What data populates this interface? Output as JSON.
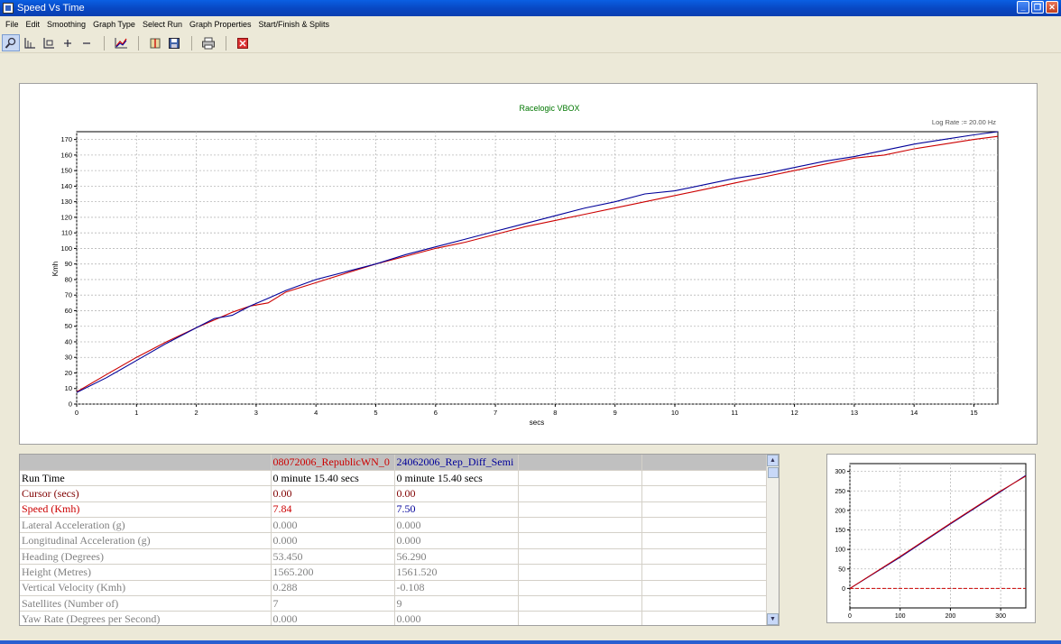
{
  "window": {
    "title": "Speed Vs Time"
  },
  "menu": [
    "File",
    "Edit",
    "Smoothing",
    "Graph Type",
    "Select Run",
    "Graph Properties",
    "Start/Finish & Splits"
  ],
  "colors": {
    "run1": "#cc0000",
    "run2": "#000099",
    "title": "#007700",
    "grid": "#c0c0c0"
  },
  "toolbar_icons": [
    "magnify-icon",
    "axis-icon",
    "zoom-axis-icon",
    "crosshair-icon",
    "minus-icon",
    "graph-settings-icon",
    "split-icon",
    "save-icon",
    "print-icon",
    "close-red-icon"
  ],
  "chart_data": [
    {
      "type": "line",
      "title": "Racelogic VBOX",
      "subtitle": "Log Rate := 20.00 Hz",
      "xlabel": "secs",
      "ylabel": "Kmh",
      "xlim": [
        0,
        15.4
      ],
      "ylim": [
        0,
        175
      ],
      "xticks": [
        0,
        1,
        2,
        3,
        4,
        5,
        6,
        7,
        8,
        9,
        10,
        11,
        12,
        13,
        14,
        15
      ],
      "yticks": [
        0,
        10,
        20,
        30,
        40,
        50,
        60,
        70,
        80,
        90,
        100,
        110,
        120,
        130,
        140,
        150,
        160,
        170
      ],
      "grid": true,
      "series": [
        {
          "color": "#cc0000",
          "x": [
            0,
            0.5,
            1,
            1.5,
            2,
            2.3,
            2.6,
            2.9,
            3.2,
            3.5,
            4,
            4.5,
            5,
            5.5,
            6,
            6.5,
            7,
            7.5,
            8,
            8.5,
            9,
            9.5,
            10,
            10.5,
            11,
            11.5,
            12,
            12.5,
            13,
            13.5,
            14,
            14.5,
            15,
            15.4
          ],
          "y": [
            7.8,
            19,
            30,
            40,
            49,
            54,
            59,
            63,
            65,
            72,
            78,
            84,
            90,
            95,
            100,
            104,
            109,
            114,
            118,
            122,
            126,
            130,
            134,
            138,
            142,
            146,
            150,
            154,
            158,
            160,
            164,
            167,
            170,
            172
          ]
        },
        {
          "color": "#000099",
          "x": [
            0,
            0.5,
            1,
            1.5,
            2,
            2.3,
            2.6,
            2.9,
            3.2,
            3.5,
            4,
            4.5,
            5,
            5.5,
            6,
            6.5,
            7,
            7.5,
            8,
            8.5,
            9,
            9.5,
            10,
            10.5,
            11,
            11.5,
            12,
            12.5,
            13,
            13.5,
            14,
            14.5,
            15,
            15.4
          ],
          "y": [
            7.5,
            17,
            28,
            39,
            49,
            55,
            57,
            63,
            68,
            73,
            80,
            85,
            90,
            96,
            101,
            106,
            111,
            116,
            121,
            126,
            130,
            135,
            137,
            141,
            145,
            148,
            152,
            156,
            159,
            163,
            167,
            170,
            173,
            175
          ]
        }
      ]
    },
    {
      "type": "line",
      "title": "",
      "xlim": [
        0,
        350
      ],
      "ylim": [
        -50,
        320
      ],
      "xticks": [
        0,
        100,
        200,
        300
      ],
      "yticks": [
        0,
        50,
        100,
        150,
        200,
        250,
        300
      ],
      "grid": true,
      "series": [
        {
          "color": "#000099",
          "x": [
            0,
            100,
            200,
            300,
            350
          ],
          "y": [
            0,
            80,
            165,
            248,
            290
          ]
        },
        {
          "color": "#cc0000",
          "x": [
            0,
            100,
            200,
            300,
            350
          ],
          "y": [
            0,
            82,
            167,
            250,
            288
          ]
        },
        {
          "color": "#cc0000",
          "x": [
            0,
            350
          ],
          "y": [
            0,
            0
          ]
        }
      ]
    }
  ],
  "table": {
    "columns": [
      "",
      "08072006_RepublicWN_0",
      "24062006_Rep_Diff_Semi",
      "",
      ""
    ],
    "rows": [
      {
        "label": "Run Time",
        "v1": "0 minute 15.40 secs",
        "v2": "0 minute 15.40 secs",
        "style": "black"
      },
      {
        "label": "Cursor (secs)",
        "v1": "0.00",
        "v2": "0.00",
        "style": "dark"
      },
      {
        "label": "Speed (Kmh)",
        "v1": "7.84",
        "v2": "7.50",
        "style": "speed"
      },
      {
        "label": "Lateral Acceleration (g)",
        "v1": "0.000",
        "v2": "0.000",
        "style": "grey"
      },
      {
        "label": "Longitudinal Acceleration (g)",
        "v1": "0.000",
        "v2": "0.000",
        "style": "grey"
      },
      {
        "label": "Heading (Degrees)",
        "v1": "53.450",
        "v2": "56.290",
        "style": "grey"
      },
      {
        "label": "Height (Metres)",
        "v1": "1565.200",
        "v2": "1561.520",
        "style": "grey"
      },
      {
        "label": "Vertical Velocity (Kmh)",
        "v1": "0.288",
        "v2": "-0.108",
        "style": "grey"
      },
      {
        "label": "Satellites (Number of)",
        "v1": "7",
        "v2": "9",
        "style": "grey"
      },
      {
        "label": "Yaw Rate (Degrees per Second)",
        "v1": "0.000",
        "v2": "0.000",
        "style": "grey"
      }
    ]
  }
}
